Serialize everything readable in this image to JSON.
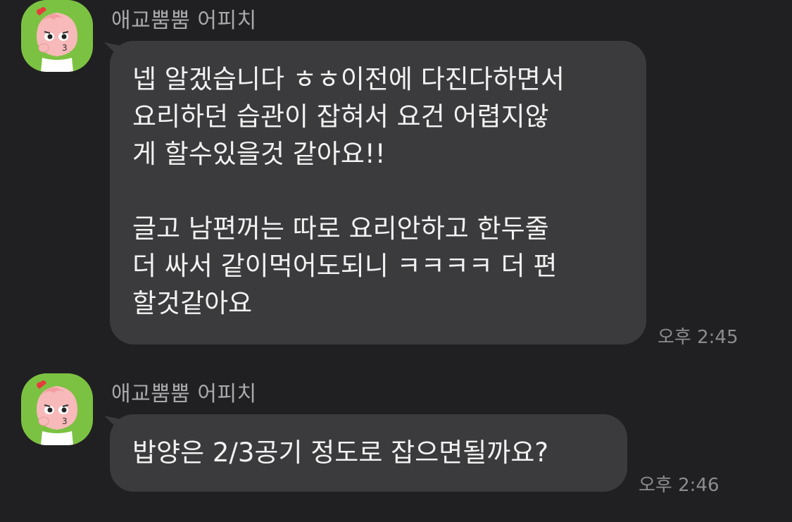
{
  "colors": {
    "background": "#202022",
    "bubble": "#3b3b3d",
    "avatar_bg": "#7cc242",
    "text": "#f2f2f2",
    "sender": "#a9a9ab",
    "time": "#8d8d90"
  },
  "messages": [
    {
      "sender": "애교뿜뿜 어피치",
      "avatar_icon": "apeach-avatar-icon",
      "lines": [
        "넵 알겠습니다 ㅎㅎ이전에 다진다하면서",
        "요리하던 습관이 잡혀서 요건 어렵지않",
        "게 할수있을것 같아요!!",
        "",
        "글고 남편꺼는 따로 요리안하고 한두줄",
        "더 싸서 같이먹어도되니 ㅋㅋㅋㅋ 더 편",
        "할것같아요"
      ],
      "time": "오후 2:45"
    },
    {
      "sender": "애교뿜뿜 어피치",
      "avatar_icon": "apeach-avatar-icon",
      "lines": [
        "밥양은 2/3공기 정도로 잡으면될까요?"
      ],
      "time": "오후 2:46"
    }
  ]
}
